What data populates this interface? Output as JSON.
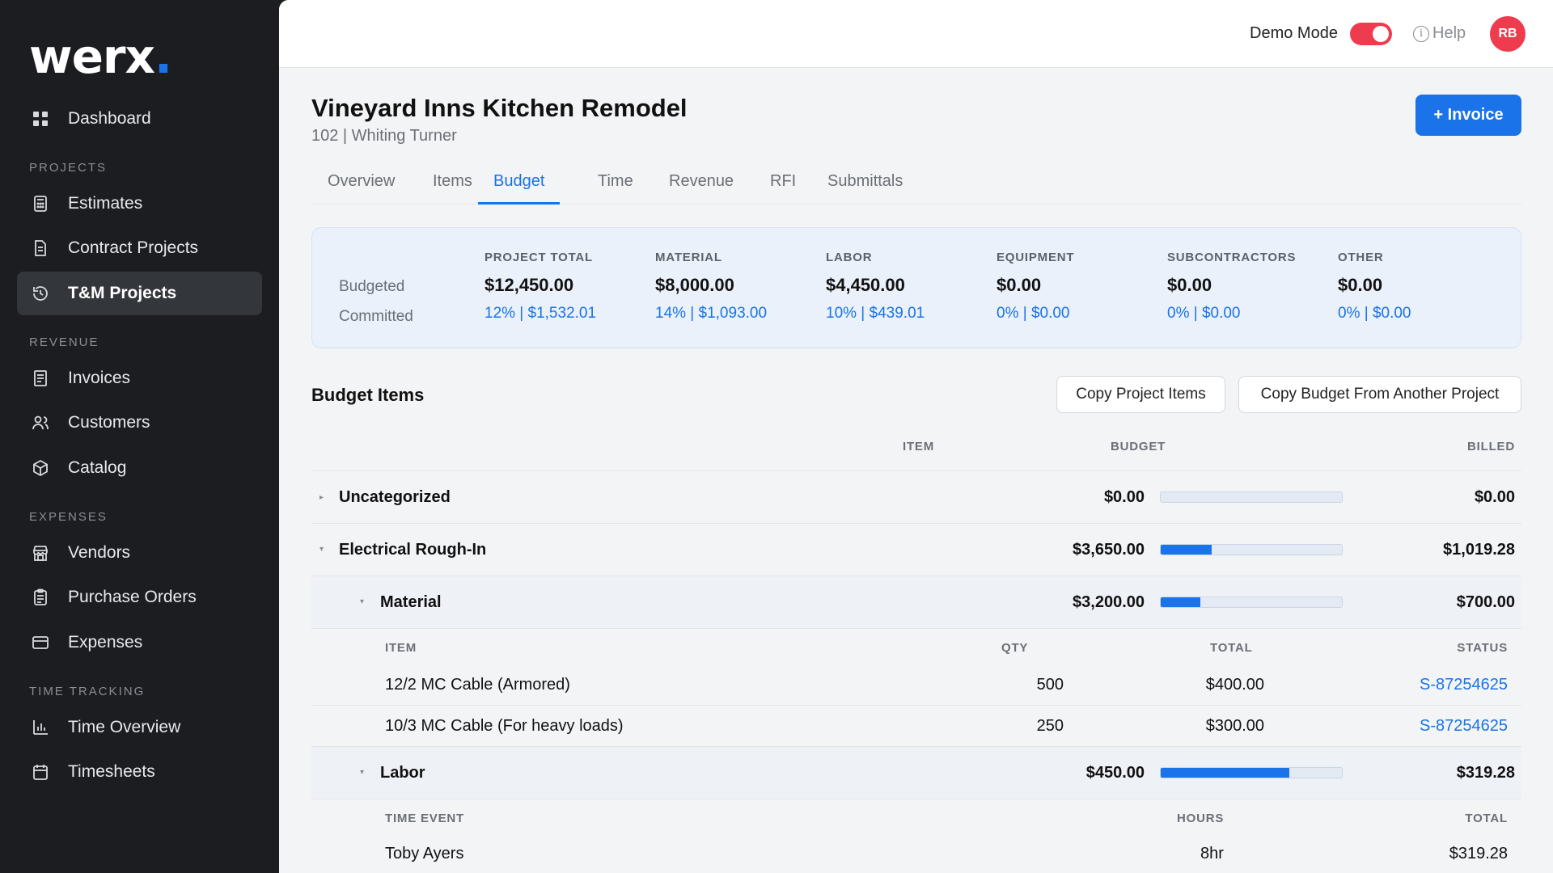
{
  "sidebar": {
    "logo": "werx",
    "logo_dot": ".",
    "dashboard": "Dashboard",
    "sections": {
      "projects": "PROJECTS",
      "revenue": "REVENUE",
      "expenses": "EXPENSES",
      "time": "TIME TRACKING"
    },
    "items": {
      "estimates": "Estimates",
      "contract_projects": "Contract Projects",
      "tm_projects": "T&M Projects",
      "invoices": "Invoices",
      "customers": "Customers",
      "catalog": "Catalog",
      "vendors": "Vendors",
      "purchase_orders": "Purchase Orders",
      "expenses": "Expenses",
      "time_overview": "Time Overview",
      "timesheets": "Timesheets"
    }
  },
  "topbar": {
    "demo_mode": "Demo Mode",
    "demo_on": true,
    "help": "Help",
    "avatar": "RB"
  },
  "project": {
    "title": "Vineyard Inns Kitchen Remodel",
    "subtitle": "102 | Whiting Turner",
    "invoice_button": "+ Invoice"
  },
  "tabs": {
    "overview": "Overview",
    "items": "Items",
    "budget": "Budget",
    "time": "Time",
    "revenue": "Revenue",
    "rfi": "RFI",
    "submittals": "Submittals"
  },
  "summary": {
    "budgeted_label": "Budgeted",
    "committed_label": "Committed",
    "cols": [
      {
        "head": "PROJECT TOTAL",
        "budgeted": "$12,450.00",
        "committed": "12% | $1,532.01"
      },
      {
        "head": "MATERIAL",
        "budgeted": "$8,000.00",
        "committed": "14% | $1,093.00"
      },
      {
        "head": "LABOR",
        "budgeted": "$4,450.00",
        "committed": "10% | $439.01"
      },
      {
        "head": "EQUIPMENT",
        "budgeted": "$0.00",
        "committed": "0% | $0.00"
      },
      {
        "head": "SUBCONTRACTORS",
        "budgeted": "$0.00",
        "committed": "0% | $0.00"
      },
      {
        "head": "OTHER",
        "budgeted": "$0.00",
        "committed": "0% | $0.00"
      }
    ]
  },
  "budget_items": {
    "title": "Budget Items",
    "copy_project_items": "Copy Project Items",
    "copy_budget": "Copy Budget From Another Project",
    "headers": {
      "item": "ITEM",
      "budget": "BUDGET",
      "billed": "BILLED"
    },
    "rows": {
      "uncategorized": {
        "name": "Uncategorized",
        "budget": "$0.00",
        "billed": "$0.00",
        "progress": 0
      },
      "electrical": {
        "name": "Electrical Rough-In",
        "budget": "$3,650.00",
        "billed": "$1,019.28",
        "progress": 0.28
      },
      "material": {
        "name": "Material",
        "budget": "$3,200.00",
        "billed": "$700.00",
        "progress": 0.22
      },
      "labor": {
        "name": "Labor",
        "budget": "$450.00",
        "billed": "$319.28",
        "progress": 0.71
      }
    },
    "material_headers": {
      "item": "ITEM",
      "qty": "QTY",
      "total": "TOTAL",
      "status": "STATUS"
    },
    "material_lines": [
      {
        "item": "12/2 MC Cable (Armored)",
        "qty": "500",
        "total": "$400.00",
        "status": "S-87254625"
      },
      {
        "item": "10/3 MC Cable (For heavy loads)",
        "qty": "250",
        "total": "$300.00",
        "status": "S-87254625"
      }
    ],
    "labor_headers": {
      "event": "TIME EVENT",
      "hours": "HOURS",
      "total": "TOTAL"
    },
    "labor_lines": [
      {
        "event": "Toby Ayers",
        "hours": "8hr",
        "total": "$319.28"
      }
    ]
  }
}
